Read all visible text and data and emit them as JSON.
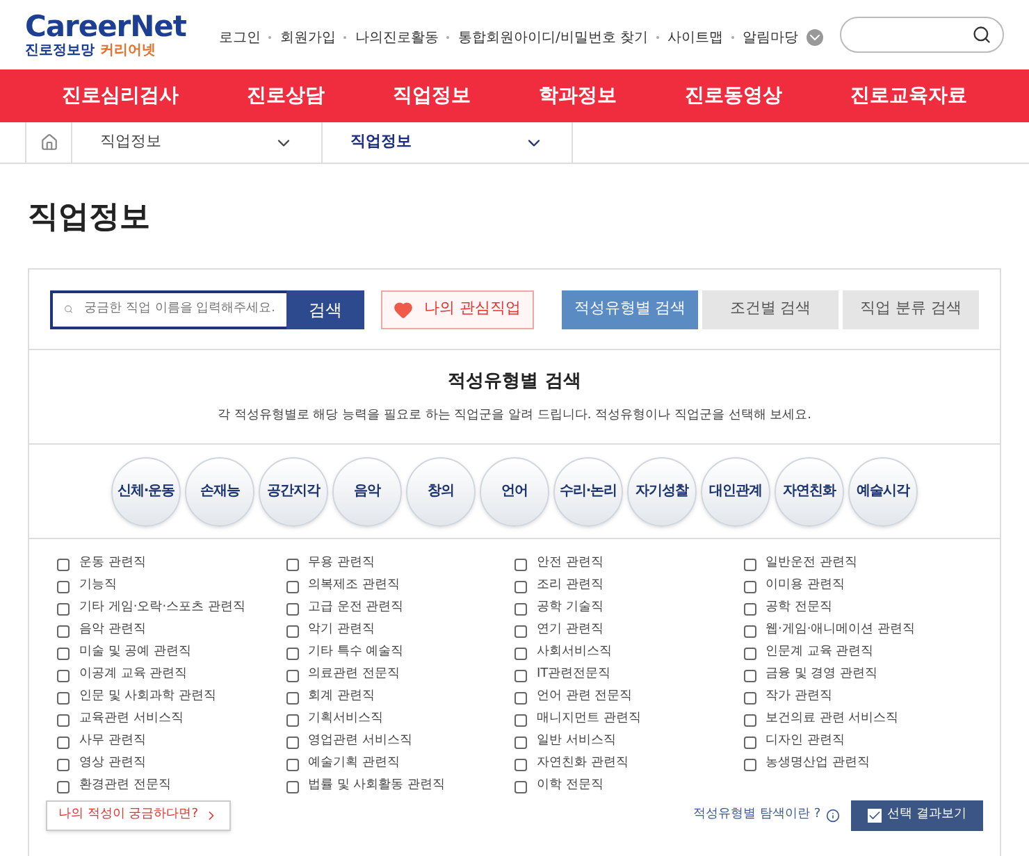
{
  "logo": {
    "brand": "CareerNet",
    "tagline_1": "진로정보망",
    "tagline_2": "커리어넷"
  },
  "top_links": [
    "로그인",
    "회원가입",
    "나의진로활동",
    "통합회원아이디/비밀번호 찾기",
    "사이트맵",
    "알림마당"
  ],
  "main_nav": [
    "진로심리검사",
    "진로상담",
    "직업정보",
    "학과정보",
    "진로동영상",
    "진로교육자료"
  ],
  "breadcrumb": [
    {
      "label": "직업정보",
      "current": false
    },
    {
      "label": "직업정보",
      "current": true
    }
  ],
  "page_title": "직업정보",
  "search": {
    "placeholder": "궁금한 직업 이름을 입력해주세요.",
    "button": "검색"
  },
  "favorites_button": "나의 관심직업",
  "search_tabs": [
    {
      "label": "적성유형별 검색",
      "selected": true
    },
    {
      "label": "조건별 검색",
      "selected": false
    },
    {
      "label": "직업 분류 검색",
      "selected": false
    }
  ],
  "section": {
    "title": "적성유형별 검색",
    "description": "각 적성유형별로 해당 능력을 필요로 하는 직업군을 알려 드립니다. 적성유형이나 직업군을 선택해 보세요."
  },
  "aptitudes": [
    "신체·운동",
    "손재능",
    "공간지각",
    "음악",
    "창의",
    "언어",
    "수리·논리",
    "자기성찰",
    "대인관계",
    "자연친화",
    "예술시각"
  ],
  "job_columns": [
    [
      {
        "label": "운동 관련직",
        "checked": false
      },
      {
        "label": "기능직",
        "checked": false
      },
      {
        "label": "기타 게임·오락·스포츠 관련직",
        "checked": false
      },
      {
        "label": "음악 관련직",
        "checked": false
      },
      {
        "label": "미술 및 공예 관련직",
        "checked": false
      },
      {
        "label": "이공계 교육 관련직",
        "checked": false
      },
      {
        "label": "인문 및 사회과학 관련직",
        "checked": false
      },
      {
        "label": "교육관련 서비스직",
        "checked": false
      },
      {
        "label": "사무 관련직",
        "checked": false
      },
      {
        "label": "영상 관련직",
        "checked": false
      },
      {
        "label": "환경관련 전문직",
        "checked": false
      }
    ],
    [
      {
        "label": "무용 관련직",
        "checked": false
      },
      {
        "label": "의복제조 관련직",
        "checked": false
      },
      {
        "label": "고급 운전 관련직",
        "checked": false
      },
      {
        "label": "악기 관련직",
        "checked": false
      },
      {
        "label": "기타 특수 예술직",
        "checked": false
      },
      {
        "label": "의료관련 전문직",
        "checked": false
      },
      {
        "label": "회계 관련직",
        "checked": false
      },
      {
        "label": "기획서비스직",
        "checked": false
      },
      {
        "label": "영업관련 서비스직",
        "checked": false
      },
      {
        "label": "예술기획 관련직",
        "checked": false
      },
      {
        "label": "법률 및 사회활동 관련직",
        "checked": false
      }
    ],
    [
      {
        "label": "안전 관련직",
        "checked": false
      },
      {
        "label": "조리 관련직",
        "checked": false
      },
      {
        "label": "공학 기술직",
        "checked": false
      },
      {
        "label": "연기 관련직",
        "checked": false
      },
      {
        "label": "사회서비스직",
        "checked": false
      },
      {
        "label": "IT관련전문직",
        "checked": false
      },
      {
        "label": "언어 관련 전문직",
        "checked": false
      },
      {
        "label": "매니지먼트 관련직",
        "checked": false
      },
      {
        "label": "일반 서비스직",
        "checked": false
      },
      {
        "label": "자연친화 관련직",
        "checked": false
      },
      {
        "label": "이학 전문직",
        "checked": false
      }
    ],
    [
      {
        "label": "일반운전 관련직",
        "checked": false
      },
      {
        "label": "이미용 관련직",
        "checked": false
      },
      {
        "label": "공학 전문직",
        "checked": false
      },
      {
        "label": "웹·게임·애니메이션 관련직",
        "checked": false
      },
      {
        "label": "인문계 교육 관련직",
        "checked": false
      },
      {
        "label": "금융 및 경영 관련직",
        "checked": false
      },
      {
        "label": "작가 관련직",
        "checked": false
      },
      {
        "label": "보건의료 관련 서비스직",
        "checked": false
      },
      {
        "label": "디자인 관련직",
        "checked": false
      },
      {
        "label": "농생명산업 관련직",
        "checked": false
      }
    ]
  ],
  "aptitude_test_link": "나의 적성이 궁금하다면?",
  "help_link": "적성유형별 탐색이란 ?",
  "results_button": "선택 결과보기"
}
